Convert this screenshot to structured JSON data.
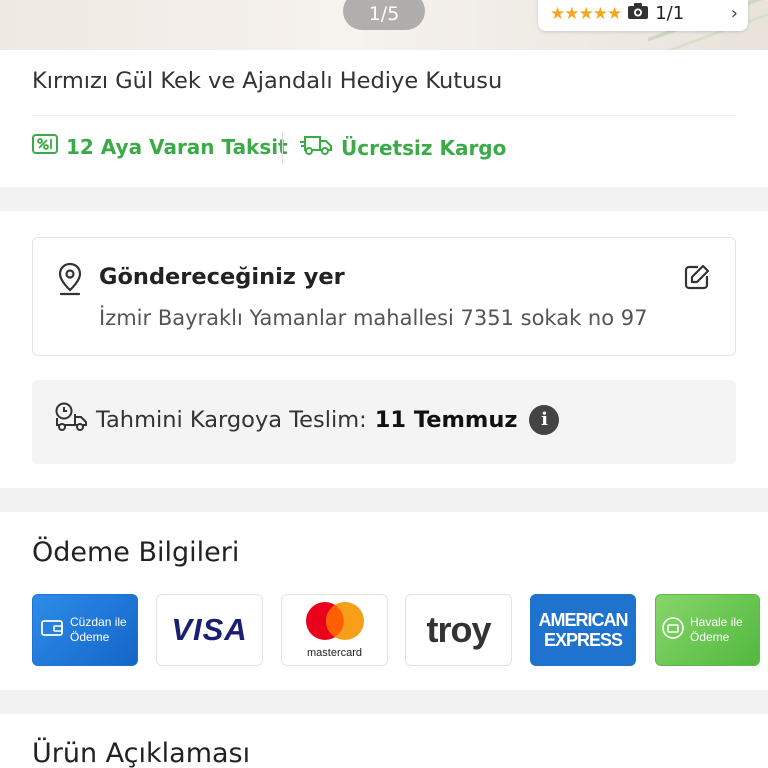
{
  "gallery": {
    "pager": "1/5",
    "rating_count": "1/1"
  },
  "product": {
    "title": "Kırmızı Gül Kek ve Ajandalı Hediye Kutusu"
  },
  "perks": {
    "installment": "12 Aya Varan Taksit",
    "shipping": "Ücretsiz Kargo"
  },
  "address": {
    "title": "Göndereceğiniz yer",
    "text": "İzmir Bayraklı Yamanlar mahallesi 7351 sokak no 97"
  },
  "delivery": {
    "label": "Tahmini Kargoya Teslim:",
    "date": "11 Temmuz"
  },
  "payment": {
    "heading": "Ödeme Bilgileri",
    "wallet_line1": "Cüzdan ile",
    "wallet_line2": "Ödeme",
    "visa": "VISA",
    "mastercard": "mastercard",
    "troy": "troy",
    "amex_line1": "AMERICAN",
    "amex_line2": "EXPRESS",
    "havale_line1": "Havale ile",
    "havale_line2": "Ödeme"
  },
  "description": {
    "heading": "Ürün Açıklaması"
  },
  "colors": {
    "accent_green": "#3bab48",
    "wallet_blue": "#1e73d6",
    "havale_green": "#5bbd45",
    "star": "#f5a623"
  }
}
